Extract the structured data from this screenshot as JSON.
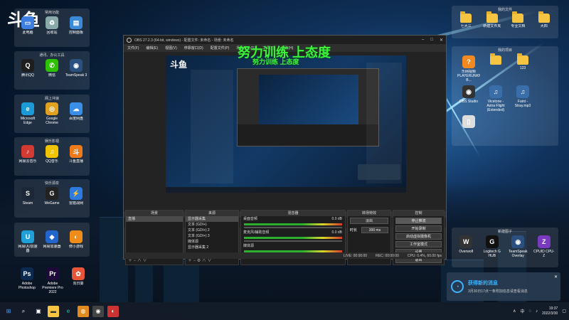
{
  "watermark_logo": "斗鱼",
  "desktop": {
    "left_groups": [
      {
        "title": "常用功能",
        "icons": [
          {
            "label": "此电脑",
            "color": "#3d7ee0",
            "glyph": "▭"
          },
          {
            "label": "回收站",
            "color": "#8aa",
            "glyph": "♻"
          },
          {
            "label": "控制面板",
            "color": "#3a8ad8",
            "glyph": "▤"
          }
        ]
      },
      {
        "title": "通讯、办公工具",
        "icons": [
          {
            "label": "腾讯QQ",
            "color": "#1e1e1e",
            "glyph": "Q"
          },
          {
            "label": "微信",
            "color": "#2dc100",
            "glyph": "✆"
          },
          {
            "label": "TeamSpeak 3",
            "color": "#2b4f7e",
            "glyph": "◉"
          }
        ]
      },
      {
        "title": "网上冲浪",
        "icons": [
          {
            "label": "Microsoft Edge",
            "color": "#1a9bd7",
            "glyph": "e"
          },
          {
            "label": "Google Chrome",
            "color": "#e0a020",
            "glyph": "◎"
          },
          {
            "label": "百度网盘",
            "color": "#3a8ee8",
            "glyph": "☁"
          }
        ]
      },
      {
        "title": "娱乐影视",
        "icons": [
          {
            "label": "网易云音乐",
            "color": "#d33a31",
            "glyph": "♪"
          },
          {
            "label": "QQ音乐",
            "color": "#f2c400",
            "glyph": "♫"
          },
          {
            "label": "斗鱼直播",
            "color": "#f07a1a",
            "glyph": "斗"
          }
        ]
      },
      {
        "title": "快乐源泉",
        "icons": [
          {
            "label": "Steam",
            "color": "#1b2838",
            "glyph": "S"
          },
          {
            "label": "WeGame",
            "color": "#222",
            "glyph": "G"
          },
          {
            "label": "雷霆战网",
            "color": "#2d7be0",
            "glyph": "⚡"
          }
        ]
      },
      {
        "title": "",
        "icons": [
          {
            "label": "网易UU加速器",
            "color": "#20a0d8",
            "glyph": "U"
          },
          {
            "label": "网易加速器",
            "color": "#2266cc",
            "glyph": "◆"
          },
          {
            "label": "修小游戏",
            "color": "#f08c1a",
            "glyph": "◐"
          }
        ]
      }
    ],
    "bottom_left_icons": [
      {
        "label": "Adobe Photoshop",
        "color": "#0c2a4f",
        "glyph": "Ps"
      },
      {
        "label": "Adobe Premiere Pro 2022",
        "color": "#1d0a3a",
        "glyph": "Pr"
      },
      {
        "label": "向日葵",
        "color": "#e8563a",
        "glyph": "✿"
      }
    ],
    "right_top_group": {
      "title": "我的文件",
      "folders": [
        "七大三",
        "新建文件夹",
        "专业文档",
        "大四"
      ]
    },
    "right_mid_group": {
      "title": "我的项目",
      "items": [
        {
          "label": "乐网视频PLAYERUNKNOWN'S B...",
          "type": "app"
        },
        {
          "label": "",
          "type": "folder"
        },
        {
          "label": "123",
          "type": "folder"
        },
        {
          "label": "OBS Studio",
          "type": "obs"
        },
        {
          "label": "Vicetone - Astra Flight (Extended)",
          "type": "music"
        },
        {
          "label": "Faint - Stray.mp3",
          "type": "music"
        },
        {
          "label": "",
          "type": "doc"
        }
      ]
    },
    "right_bottom_group": {
      "title": "新建图子",
      "icons": [
        {
          "label": "Overwolf",
          "color": "#333",
          "glyph": "W"
        },
        {
          "label": "Logitech G HUB",
          "color": "#111",
          "glyph": "G"
        },
        {
          "label": "TeamSpeak Overlay",
          "color": "#2b4f7e",
          "glyph": "◉"
        },
        {
          "label": "CPUID CPU-Z",
          "color": "#7a3ac0",
          "glyph": "Z"
        }
      ]
    }
  },
  "obs": {
    "title": "OBS 27.2.3 (64-bit, windows) - 配置文件: 未命名 - 场景: 未命名",
    "menu": [
      "文件(F)",
      "编辑(E)",
      "视图(V)",
      "停靠窗口(D)",
      "配置文件(P)",
      "场景集合(S)",
      "工具(T)",
      "帮助(H)"
    ],
    "slogan": "努力训练 上态度",
    "inner_slogan": "努力训练 上态度",
    "scenes_tabs": [
      "场景",
      "来源"
    ],
    "docks": {
      "scenes": {
        "header": "场景",
        "items": [
          "直播"
        ]
      },
      "sources": {
        "header": "来源",
        "items": [
          "显示器采集",
          "文本 (GDI+)",
          "文本 (GDI+) 2",
          "文本 (GDI+) 3",
          "媒体源",
          "显示器采集 2"
        ]
      },
      "mixer": {
        "header": "混音器",
        "channels": [
          {
            "name": "桌面音频",
            "db": "0.0 dB"
          },
          {
            "name": "麦克风/辅助音频",
            "db": "0.0 dB"
          },
          {
            "name": "媒体源",
            "db": ""
          }
        ]
      },
      "transitions": {
        "header": "转场特效",
        "type": "淡出",
        "duration_label": "时长",
        "duration": "300 ms"
      },
      "controls": {
        "header": "控制",
        "buttons": [
          "停止推流",
          "开始录制",
          "启动虚拟摄像机",
          "工作室模式",
          "设置",
          "退出"
        ]
      }
    },
    "status": {
      "live": "LIVE: 00:00:00",
      "rec": "REC: 00:00:00",
      "cpu": "CPU: 0.4%, 60.00 fps"
    }
  },
  "notification": {
    "title": "获得新的消息",
    "body": "3月30日17点一条附加信息请查看消息"
  },
  "taskbar": {
    "time": "19:37",
    "date": "2022/3/30",
    "lang": "中"
  }
}
